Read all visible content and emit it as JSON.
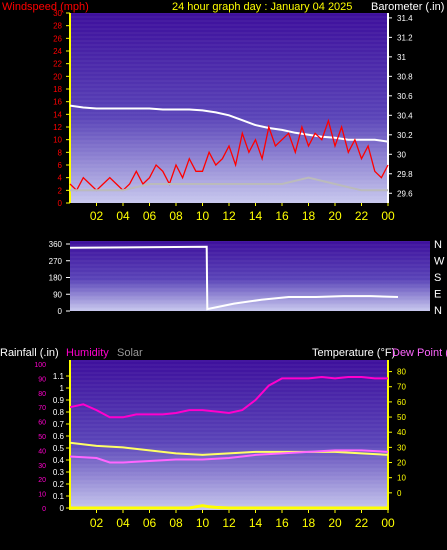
{
  "header": {
    "windspeed_label": "Windspeed (mph)",
    "title": "24 hour graph day : January 04 2025",
    "barometer_label": "Barometer (.in)"
  },
  "footer_labels": {
    "rainfall": "Rainfall (.in)",
    "humidity": "Humidity",
    "solar": "Solar",
    "temperature": "Temperature (°F)",
    "dewpoint": "Dew Point ("
  },
  "colors": {
    "wind": "#ff0000",
    "humidity": "#ff00cc",
    "solar": "#999999",
    "temperature": "#ffff66",
    "dewpoint": "#ff66ff",
    "rain": "#ffff00",
    "white": "#ffffff",
    "axis_yellow": "#ffff00"
  },
  "chart_data": [
    {
      "type": "line",
      "id": "wind-baro",
      "title": "24 hour graph day : January 04 2025",
      "x_ticks": [
        "02",
        "04",
        "06",
        "08",
        "10",
        "12",
        "14",
        "16",
        "18",
        "20",
        "22",
        "00"
      ],
      "y_left_label": "Windspeed (mph)",
      "y_left_ticks": [
        30,
        28,
        26,
        24,
        22,
        20,
        18,
        16,
        14,
        12,
        10,
        8,
        6,
        4,
        2,
        0
      ],
      "y_left_range": [
        0,
        30
      ],
      "y_right_label": "Barometer (.in)",
      "y_right_ticks": [
        "31.4",
        "31.2",
        "31",
        "30.8",
        "30.6",
        "30.4",
        "30.2",
        "30",
        "29.8",
        "29.6"
      ],
      "y_right_range": [
        29.5,
        31.45
      ],
      "series": [
        {
          "name": "Barometer",
          "axis": "right",
          "color": "#ffffff",
          "x": [
            0,
            1,
            2,
            3,
            4,
            5,
            6,
            7,
            8,
            9,
            10,
            11,
            12,
            13,
            14,
            15,
            16,
            17,
            18,
            19,
            20,
            21,
            22,
            23,
            24
          ],
          "y": [
            30.5,
            30.48,
            30.47,
            30.47,
            30.47,
            30.47,
            30.47,
            30.46,
            30.46,
            30.46,
            30.45,
            30.43,
            30.4,
            30.35,
            30.3,
            30.27,
            30.25,
            30.22,
            30.2,
            30.18,
            30.17,
            30.15,
            30.15,
            30.15,
            30.13
          ]
        },
        {
          "name": "Windspeed",
          "axis": "left",
          "color": "#ff0000",
          "x": [
            0,
            0.5,
            1,
            1.5,
            2,
            2.5,
            3,
            3.5,
            4,
            4.5,
            5,
            5.5,
            6,
            6.5,
            7,
            7.5,
            8,
            8.5,
            9,
            9.5,
            10,
            10.5,
            11,
            11.5,
            12,
            12.5,
            13,
            13.5,
            14,
            14.5,
            15,
            15.5,
            16,
            16.5,
            17,
            17.5,
            18,
            18.5,
            19,
            19.5,
            20,
            20.5,
            21,
            21.5,
            22,
            22.5,
            23,
            23.5,
            24
          ],
          "y": [
            3,
            2,
            4,
            3,
            2,
            3,
            4,
            3,
            2,
            3,
            5,
            3,
            4,
            6,
            5,
            3,
            6,
            4,
            7,
            5,
            5,
            8,
            6,
            7,
            9,
            6,
            11,
            8,
            10,
            7,
            12,
            9,
            10,
            11,
            8,
            12,
            9,
            11,
            10,
            13,
            9,
            12,
            8,
            10,
            7,
            9,
            5,
            4,
            6
          ]
        },
        {
          "name": "Wind average",
          "axis": "left",
          "color": "#bbbbbb",
          "x": [
            0,
            2,
            4,
            6,
            8,
            10,
            12,
            14,
            16,
            18,
            20,
            22,
            24
          ],
          "y": [
            2,
            2,
            2,
            3,
            3,
            3,
            3,
            3,
            3,
            4,
            3,
            2,
            2
          ]
        }
      ]
    },
    {
      "type": "line",
      "id": "wind-direction",
      "x_ticks": [],
      "y_left_ticks": [
        360,
        270,
        180,
        90,
        0
      ],
      "y_right_ticks": [
        "N",
        "W",
        "S",
        "E",
        "N"
      ],
      "y_range": [
        0,
        360
      ],
      "series": [
        {
          "name": "Wind direction",
          "color": "#ffffff",
          "x": [
            0,
            10,
            10.05,
            12,
            14,
            16,
            18,
            20,
            22,
            24
          ],
          "y": [
            340,
            345,
            10,
            40,
            60,
            75,
            75,
            80,
            80,
            75
          ]
        }
      ]
    },
    {
      "type": "line",
      "id": "temp-humidity",
      "x_ticks": [
        "02",
        "04",
        "06",
        "08",
        "10",
        "12",
        "14",
        "16",
        "18",
        "20",
        "22",
        "00"
      ],
      "y_left_ticks": [
        100,
        90,
        80,
        70,
        60,
        50,
        40,
        30,
        20,
        10,
        0
      ],
      "y_left_range": [
        0,
        100
      ],
      "y_rain_ticks": [
        "1.1",
        "1",
        "0.9",
        "0.8",
        "0.7",
        "0.6",
        "0.5",
        "0.4",
        "0.3",
        "0.2",
        "0.1",
        "0"
      ],
      "y_right_ticks": [
        80,
        70,
        60,
        50,
        40,
        30,
        20,
        10,
        0
      ],
      "y_right_range": [
        -10,
        85
      ],
      "series": [
        {
          "name": "Humidity",
          "axis": "left",
          "color": "#ff00cc",
          "x": [
            0,
            1,
            2,
            3,
            4,
            5,
            6,
            7,
            8,
            9,
            10,
            11,
            12,
            13,
            14,
            15,
            16,
            17,
            18,
            19,
            20,
            21,
            22,
            23,
            24
          ],
          "y": [
            70,
            72,
            68,
            63,
            63,
            65,
            65,
            65,
            66,
            68,
            68,
            67,
            66,
            68,
            75,
            85,
            90,
            90,
            90,
            91,
            90,
            91,
            91,
            90,
            90
          ]
        },
        {
          "name": "Temperature",
          "axis": "right",
          "color": "#ffff66",
          "x": [
            0,
            2,
            4,
            6,
            8,
            10,
            12,
            14,
            16,
            18,
            20,
            22,
            24
          ],
          "y": [
            33,
            31,
            30,
            28,
            26,
            25,
            26,
            27,
            27,
            27,
            27,
            26,
            25
          ]
        },
        {
          "name": "Dew Point",
          "axis": "right",
          "color": "#ff66ff",
          "x": [
            0,
            2,
            3,
            4,
            6,
            8,
            10,
            12,
            14,
            16,
            18,
            20,
            22,
            24
          ],
          "y": [
            24,
            23,
            20,
            20,
            21,
            22,
            22,
            23,
            25,
            26,
            27,
            28,
            28,
            27
          ]
        },
        {
          "name": "Rainfall",
          "axis": "rain",
          "color": "#ffff00",
          "x": [
            0,
            9,
            9.5,
            10,
            10.5,
            11,
            12,
            24
          ],
          "y": [
            0,
            0,
            0.01,
            0.02,
            0.01,
            0.005,
            0,
            0
          ]
        }
      ]
    }
  ]
}
